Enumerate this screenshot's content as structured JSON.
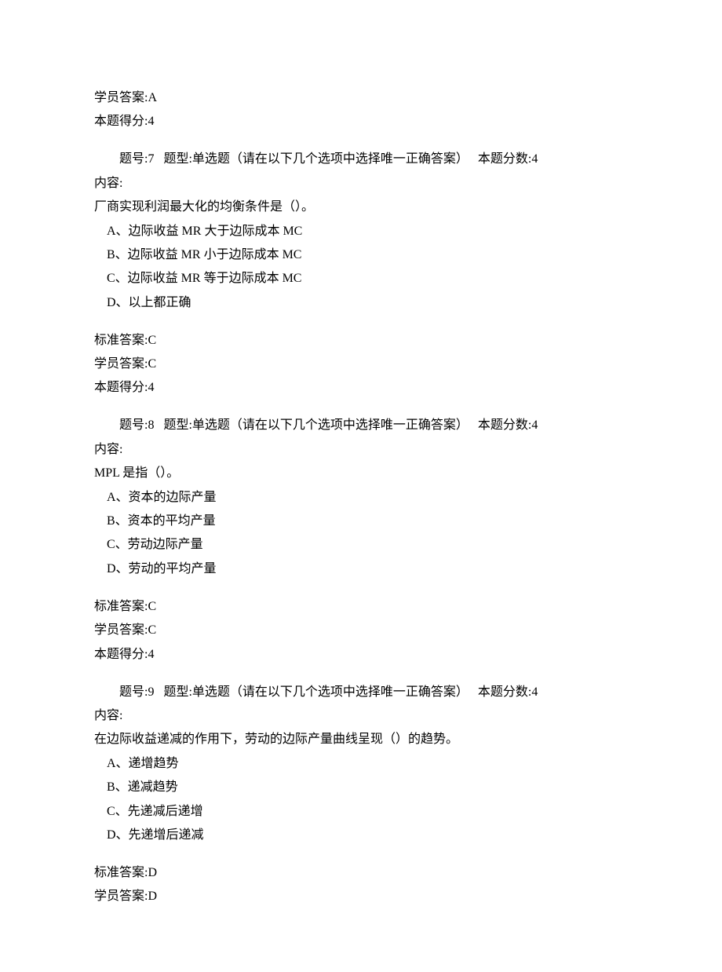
{
  "prev": {
    "student_answer_label": "学员答案:",
    "student_answer_value": "A",
    "score_label": "本题得分:",
    "score_value": "4"
  },
  "questions": [
    {
      "header_num_label": "题号:",
      "header_num": "7",
      "header_type_label": "题型:",
      "header_type_value": "单选题（请在以下几个选项中选择唯一正确答案）",
      "header_score_label": "本题分数:",
      "header_score_value": "4",
      "content_label": "内容:",
      "content_text": "厂商实现利润最大化的均衡条件是（）。",
      "options": [
        "A、边际收益 MR 大于边际成本 MC",
        "B、边际收益 MR 小于边际成本 MC",
        "C、边际收益 MR 等于边际成本 MC",
        "D、以上都正确"
      ],
      "std_answer_label": "标准答案:",
      "std_answer_value": "C",
      "student_answer_label": "学员答案:",
      "student_answer_value": "C",
      "score_label": "本题得分:",
      "score_value": "4"
    },
    {
      "header_num_label": "题号:",
      "header_num": "8",
      "header_type_label": "题型:",
      "header_type_value": "单选题（请在以下几个选项中选择唯一正确答案）",
      "header_score_label": "本题分数:",
      "header_score_value": "4",
      "content_label": "内容:",
      "content_text": "MPL 是指（）。",
      "options": [
        "A、资本的边际产量",
        "B、资本的平均产量",
        "C、劳动边际产量",
        "D、劳动的平均产量"
      ],
      "std_answer_label": "标准答案:",
      "std_answer_value": "C",
      "student_answer_label": "学员答案:",
      "student_answer_value": "C",
      "score_label": "本题得分:",
      "score_value": "4"
    },
    {
      "header_num_label": "题号:",
      "header_num": "9",
      "header_type_label": "题型:",
      "header_type_value": "单选题（请在以下几个选项中选择唯一正确答案）",
      "header_score_label": "本题分数:",
      "header_score_value": "4",
      "content_label": "内容:",
      "content_text": "在边际收益递减的作用下，劳动的边际产量曲线呈现（）的趋势。",
      "options": [
        "A、递增趋势",
        "B、递减趋势",
        "C、先递减后递增",
        "D、先递增后递减"
      ],
      "std_answer_label": "标准答案:",
      "std_answer_value": "D",
      "student_answer_label": "学员答案:",
      "student_answer_value": "D"
    }
  ]
}
